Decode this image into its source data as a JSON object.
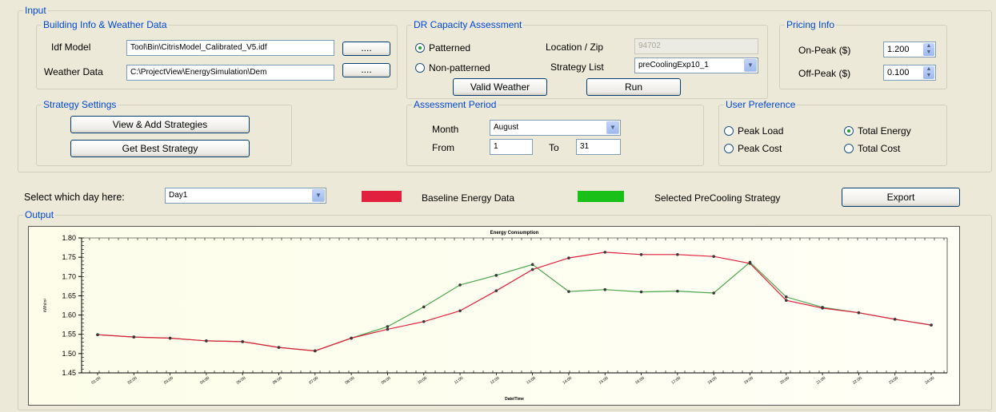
{
  "input_group": {
    "legend": "Input"
  },
  "building": {
    "legend": "Building Info & Weather Data",
    "idf_label": "Idf Model",
    "idf_value": "Tool\\Bin\\CitrisModel_Calibrated_V5.idf",
    "weather_label": "Weather Data",
    "weather_value": "C:\\ProjectView\\EnergySimulation\\Dem",
    "browse_label": "...."
  },
  "dr": {
    "legend": "DR Capacity Assessment",
    "patterned_label": "Patterned",
    "nonpatterned_label": "Non-patterned",
    "location_label": "Location / Zip",
    "location_value": "94702",
    "strategy_label": "Strategy List",
    "strategy_value": "preCoolingExp10_1",
    "valid_weather_label": "Valid Weather",
    "run_label": "Run"
  },
  "pricing": {
    "legend": "Pricing Info",
    "onpeak_label": "On-Peak ($)",
    "onpeak_value": "1.200",
    "offpeak_label": "Off-Peak ($)",
    "offpeak_value": "0.100"
  },
  "strategy_settings": {
    "legend": "Strategy Settings",
    "view_add_label": "View & Add Strategies",
    "get_best_label": "Get Best Strategy"
  },
  "period": {
    "legend": "Assessment Period",
    "month_label": "Month",
    "month_value": "August",
    "from_label": "From",
    "from_value": "1",
    "to_label": "To",
    "to_value": "31"
  },
  "preference": {
    "legend": "User Preference",
    "peak_load": "Peak Load",
    "total_energy": "Total Energy",
    "peak_cost": "Peak Cost",
    "total_cost": "Total Cost"
  },
  "day_select": {
    "label": "Select which day here:",
    "value": "Day1"
  },
  "legend_bar": {
    "baseline_label": "Baseline Energy Data",
    "baseline_color": "#e0203c",
    "selected_label": "Selected PreCooling Strategy",
    "selected_color": "#18c018",
    "export_label": "Export"
  },
  "output_group": {
    "legend": "Output"
  },
  "chart_data": {
    "type": "line",
    "title": "Energy Consumption",
    "xlabel": "Date/Time",
    "ylabel": "kWh/m²",
    "ylim": [
      1.45,
      1.8
    ],
    "yticks": [
      "1.45",
      "1.50",
      "1.55",
      "1.60",
      "1.65",
      "1.70",
      "1.75",
      "1.80"
    ],
    "x": [
      "01:00",
      "02:00",
      "03:00",
      "04:00",
      "05:00",
      "06:00",
      "07:00",
      "08:00",
      "09:00",
      "10:00",
      "11:00",
      "12:00",
      "13:00",
      "14:00",
      "15:00",
      "16:00",
      "17:00",
      "18:00",
      "19:00",
      "20:00",
      "21:00",
      "22:00",
      "23:00",
      "24:00"
    ],
    "series": [
      {
        "name": "Baseline Energy Data",
        "color": "#e0203c",
        "values": [
          1.549,
          1.543,
          1.54,
          1.533,
          1.531,
          1.516,
          1.507,
          1.54,
          1.563,
          1.583,
          1.611,
          1.663,
          1.718,
          1.748,
          1.763,
          1.757,
          1.757,
          1.752,
          1.734,
          1.638,
          1.618,
          1.606,
          1.589,
          1.574
        ]
      },
      {
        "name": "Selected PreCooling Strategy",
        "color": "#4ca64c",
        "values": [
          1.549,
          1.543,
          1.54,
          1.533,
          1.531,
          1.516,
          1.507,
          1.54,
          1.57,
          1.621,
          1.678,
          1.703,
          1.731,
          1.661,
          1.666,
          1.66,
          1.662,
          1.657,
          1.737,
          1.647,
          1.62,
          1.606,
          1.589,
          1.574
        ]
      }
    ],
    "grid": false
  }
}
